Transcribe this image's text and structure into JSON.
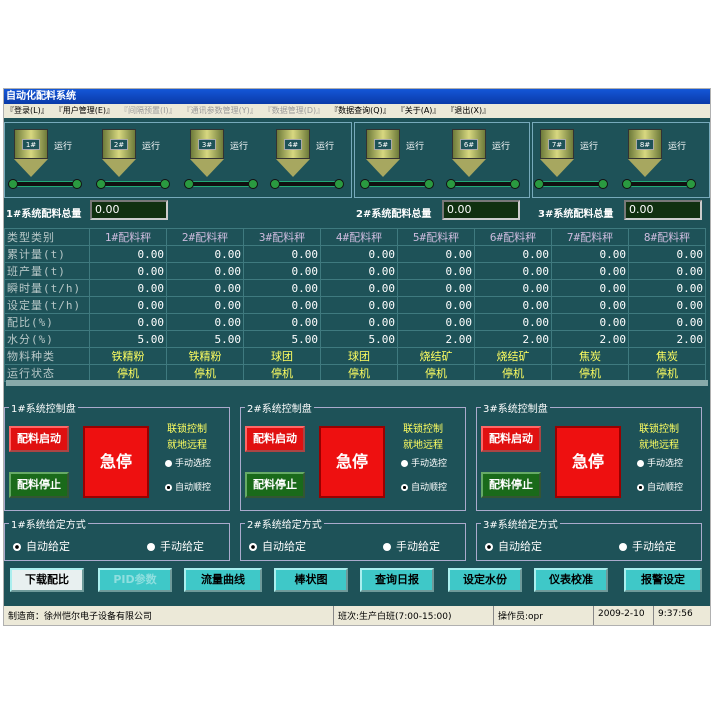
{
  "window": {
    "title": "自动化配料系统"
  },
  "menu": [
    {
      "label": "『登录(L)』",
      "enabled": true
    },
    {
      "label": "『用户管理(E)』",
      "enabled": true
    },
    {
      "label": "『间隔预置(I)』",
      "enabled": false
    },
    {
      "label": "『通讯参数管理(Y)』",
      "enabled": false
    },
    {
      "label": "『数据管理(D)』",
      "enabled": false
    },
    {
      "label": "『数据查询(Q)』",
      "enabled": true
    },
    {
      "label": "『关于(A)』",
      "enabled": true
    },
    {
      "label": "『退出(X)』",
      "enabled": true
    }
  ],
  "hoppers": [
    {
      "label": "1#",
      "state": "运行"
    },
    {
      "label": "2#",
      "state": "运行"
    },
    {
      "label": "3#",
      "state": "运行"
    },
    {
      "label": "4#",
      "state": "运行"
    },
    {
      "label": "5#",
      "state": "运行"
    },
    {
      "label": "6#",
      "state": "运行"
    },
    {
      "label": "7#",
      "state": "运行"
    },
    {
      "label": "8#",
      "state": "运行"
    }
  ],
  "totals": [
    {
      "label": "1#系统配料总量",
      "value": "0.00"
    },
    {
      "label": "2#系统配料总量",
      "value": "0.00"
    },
    {
      "label": "3#系统配料总量",
      "value": "0.00"
    }
  ],
  "table": {
    "header": [
      "类型类别",
      "1#配料秤",
      "2#配料秤",
      "3#配料秤",
      "4#配料秤",
      "5#配料秤",
      "6#配料秤",
      "7#配料秤",
      "8#配料秤"
    ],
    "rows": [
      {
        "name": "累计量(t)",
        "cells": [
          "0.00",
          "0.00",
          "0.00",
          "0.00",
          "0.00",
          "0.00",
          "0.00",
          "0.00"
        ]
      },
      {
        "name": "班产量(t)",
        "cells": [
          "0.00",
          "0.00",
          "0.00",
          "0.00",
          "0.00",
          "0.00",
          "0.00",
          "0.00"
        ]
      },
      {
        "name": "瞬时量(t/h)",
        "cells": [
          "0.00",
          "0.00",
          "0.00",
          "0.00",
          "0.00",
          "0.00",
          "0.00",
          "0.00"
        ]
      },
      {
        "name": "设定量(t/h)",
        "cells": [
          "0.00",
          "0.00",
          "0.00",
          "0.00",
          "0.00",
          "0.00",
          "0.00",
          "0.00"
        ]
      },
      {
        "name": "配比(%)",
        "cells": [
          "0.00",
          "0.00",
          "0.00",
          "0.00",
          "0.00",
          "0.00",
          "0.00",
          "0.00"
        ]
      },
      {
        "name": "水分(%)",
        "cells": [
          "5.00",
          "5.00",
          "5.00",
          "5.00",
          "2.00",
          "2.00",
          "2.00",
          "2.00"
        ]
      },
      {
        "name": "物料种类",
        "cells": [
          "铁精粉",
          "铁精粉",
          "球团",
          "球团",
          "烧结矿",
          "烧结矿",
          "焦炭",
          "焦炭"
        ],
        "text": true
      },
      {
        "name": "运行状态",
        "cells": [
          "停机",
          "停机",
          "停机",
          "停机",
          "停机",
          "停机",
          "停机",
          "停机"
        ],
        "text": true
      }
    ]
  },
  "control": [
    {
      "title": "1#系统控制盘",
      "start": "配料启动",
      "stop": "配料停止",
      "estop": "急停",
      "interlock": "联锁控制",
      "local": "就地远程",
      "manual": "手动选控",
      "auto": "自动顺控"
    },
    {
      "title": "2#系统控制盘",
      "start": "配料启动",
      "stop": "配料停止",
      "estop": "急停",
      "interlock": "联锁控制",
      "local": "就地远程",
      "manual": "手动选控",
      "auto": "自动顺控"
    },
    {
      "title": "3#系统控制盘",
      "start": "配料启动",
      "stop": "配料停止",
      "estop": "急停",
      "interlock": "联锁控制",
      "local": "就地远程",
      "manual": "手动选控",
      "auto": "自动顺控"
    }
  ],
  "mode": [
    {
      "title": "1#系统给定方式",
      "auto": "自动给定",
      "manual": "手动给定"
    },
    {
      "title": "2#系统给定方式",
      "auto": "自动给定",
      "manual": "手动给定"
    },
    {
      "title": "3#系统给定方式",
      "auto": "自动给定",
      "manual": "手动给定"
    }
  ],
  "buttons": [
    {
      "label": "下载配比",
      "enabled": true
    },
    {
      "label": "PID参数",
      "enabled": false
    },
    {
      "label": "流量曲线",
      "enabled": true
    },
    {
      "label": "棒状图",
      "enabled": true
    },
    {
      "label": "查询日报",
      "enabled": true
    },
    {
      "label": "设定水份",
      "enabled": true
    },
    {
      "label": "仪表校准",
      "enabled": true
    },
    {
      "label": "报警设定",
      "enabled": true
    }
  ],
  "status": {
    "maker": "制造商：徐州恺尔电子设备有限公司",
    "shift": "班次:生产白班(7:00-15:00)",
    "operator": "操作员:opr",
    "date": "2009-2-10",
    "time": "9:37:56"
  }
}
